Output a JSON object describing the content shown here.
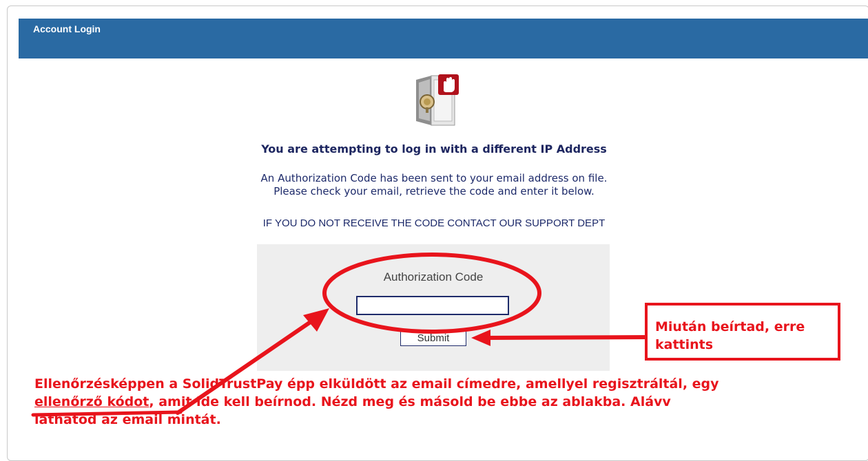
{
  "header": {
    "title": "Account Login"
  },
  "icons": {
    "vault": "lock-safe-icon",
    "stop_hand": "stop-hand-icon"
  },
  "main": {
    "heading": "You are attempting to log in with a different IP Address",
    "message_line1": "An Authorization Code has been sent to your email address on file.",
    "message_line2": "Please check your email, retrieve the code and enter it below.",
    "notice": "IF YOU DO NOT RECEIVE THE CODE CONTACT OUR SUPPORT DEPT"
  },
  "form": {
    "label": "Authorization Code",
    "value": "",
    "submit_label": "Submit"
  },
  "annotations": {
    "callout_line1": "Miután beírtad, erre",
    "callout_line2": "kattints",
    "note_line1": "Ellenőrzésképpen a SolidTrustPay épp elküldött az email címedre, amellyel regisztráltál, egy",
    "note_line2_underlined": "ellenőrző kódot",
    "note_line2_rest": ", amit ide kell beírnod. Nézd meg és másold be ebbe az ablakba. Alávv",
    "note_line3": "láthatod az email mintát."
  },
  "colors": {
    "header_bg": "#2a6aa3",
    "text_navy": "#1d2660",
    "annotation_red": "#e8141c",
    "form_bg": "#eeeeee"
  }
}
